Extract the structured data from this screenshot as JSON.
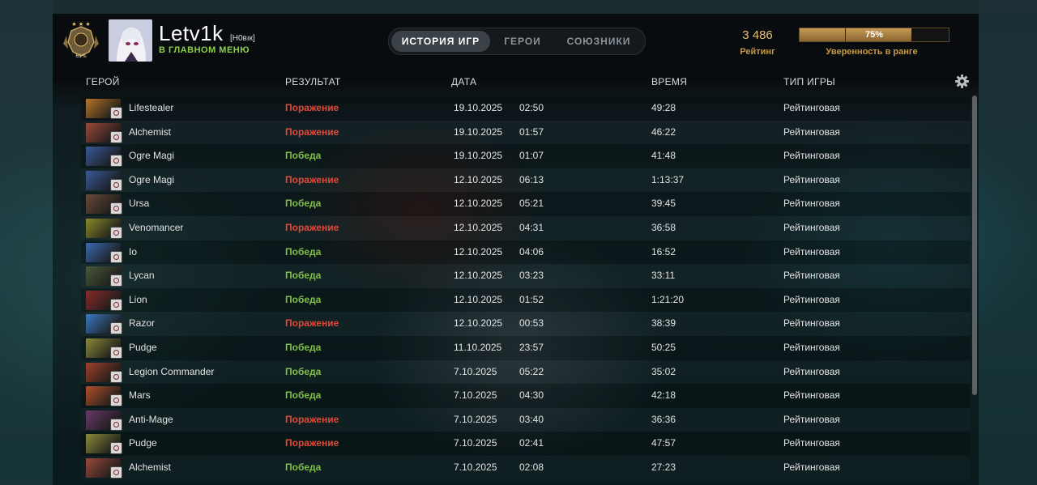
{
  "player": {
    "name": "Letv1k",
    "tag": "[Н0вıк]",
    "status": "В ГЛАВНОМ МЕНЮ",
    "medal_percent": "61%",
    "rank_stars": "★ ★ ★"
  },
  "tabs": [
    {
      "label": "ИСТОРИЯ ИГР",
      "active": true
    },
    {
      "label": "ГЕРОИ",
      "active": false
    },
    {
      "label": "СОЮЗНИКИ",
      "active": false
    }
  ],
  "rating": {
    "value": "3 486",
    "label": "Рейтинг",
    "confidence_text": "75%",
    "confidence_fraction": 0.75,
    "confidence_label": "Уверенность в ранге"
  },
  "columns": {
    "hero": "ГЕРОЙ",
    "result": "РЕЗУЛЬТАТ",
    "date": "ДАТА",
    "duration": "ВРЕМЯ",
    "type": "ТИП ИГРЫ"
  },
  "colors": {
    "loss": "#e04a3a",
    "win": "#7fbf4a",
    "accent_gold": "#c79a45",
    "status_green": "#8bd14a"
  },
  "matches": [
    {
      "hero": "Lifestealer",
      "result": "Поражение",
      "outcome": "loss",
      "date": "19.10.2025",
      "time": "02:50",
      "duration": "49:28",
      "type": "Рейтинговая",
      "hero_color": "#b5742a"
    },
    {
      "hero": "Alchemist",
      "result": "Поражение",
      "outcome": "loss",
      "date": "19.10.2025",
      "time": "01:57",
      "duration": "46:22",
      "type": "Рейтинговая",
      "hero_color": "#9a4a3a"
    },
    {
      "hero": "Ogre Magi",
      "result": "Победа",
      "outcome": "win",
      "date": "19.10.2025",
      "time": "01:07",
      "duration": "41:48",
      "type": "Рейтинговая",
      "hero_color": "#3a5a9a"
    },
    {
      "hero": "Ogre Magi",
      "result": "Поражение",
      "outcome": "loss",
      "date": "12.10.2025",
      "time": "06:13",
      "duration": "1:13:37",
      "type": "Рейтинговая",
      "hero_color": "#3a5a9a"
    },
    {
      "hero": "Ursa",
      "result": "Победа",
      "outcome": "win",
      "date": "12.10.2025",
      "time": "05:21",
      "duration": "39:45",
      "type": "Рейтинговая",
      "hero_color": "#6a4a3a"
    },
    {
      "hero": "Venomancer",
      "result": "Поражение",
      "outcome": "loss",
      "date": "12.10.2025",
      "time": "04:31",
      "duration": "36:58",
      "type": "Рейтинговая",
      "hero_color": "#8a8a2a"
    },
    {
      "hero": "Io",
      "result": "Победа",
      "outcome": "win",
      "date": "12.10.2025",
      "time": "04:06",
      "duration": "16:52",
      "type": "Рейтинговая",
      "hero_color": "#3a6ab0"
    },
    {
      "hero": "Lycan",
      "result": "Победа",
      "outcome": "win",
      "date": "12.10.2025",
      "time": "03:23",
      "duration": "33:11",
      "type": "Рейтинговая",
      "hero_color": "#4a5a3a"
    },
    {
      "hero": "Lion",
      "result": "Победа",
      "outcome": "win",
      "date": "12.10.2025",
      "time": "01:52",
      "duration": "1:21:20",
      "type": "Рейтинговая",
      "hero_color": "#8a2a2a"
    },
    {
      "hero": "Razor",
      "result": "Поражение",
      "outcome": "loss",
      "date": "12.10.2025",
      "time": "00:53",
      "duration": "38:39",
      "type": "Рейтинговая",
      "hero_color": "#3a7ac0"
    },
    {
      "hero": "Pudge",
      "result": "Победа",
      "outcome": "win",
      "date": "11.10.2025",
      "time": "23:57",
      "duration": "50:25",
      "type": "Рейтинговая",
      "hero_color": "#8a8a3a"
    },
    {
      "hero": "Legion Commander",
      "result": "Победа",
      "outcome": "win",
      "date": "7.10.2025",
      "time": "05:22",
      "duration": "35:02",
      "type": "Рейтинговая",
      "hero_color": "#a0402a"
    },
    {
      "hero": "Mars",
      "result": "Победа",
      "outcome": "win",
      "date": "7.10.2025",
      "time": "04:30",
      "duration": "42:18",
      "type": "Рейтинговая",
      "hero_color": "#b0502a"
    },
    {
      "hero": "Anti-Mage",
      "result": "Поражение",
      "outcome": "loss",
      "date": "7.10.2025",
      "time": "03:40",
      "duration": "36:36",
      "type": "Рейтинговая",
      "hero_color": "#6a3a6a"
    },
    {
      "hero": "Pudge",
      "result": "Поражение",
      "outcome": "loss",
      "date": "7.10.2025",
      "time": "02:41",
      "duration": "47:57",
      "type": "Рейтинговая",
      "hero_color": "#8a8a3a"
    },
    {
      "hero": "Alchemist",
      "result": "Победа",
      "outcome": "win",
      "date": "7.10.2025",
      "time": "02:08",
      "duration": "27:23",
      "type": "Рейтинговая",
      "hero_color": "#9a4a3a"
    }
  ]
}
